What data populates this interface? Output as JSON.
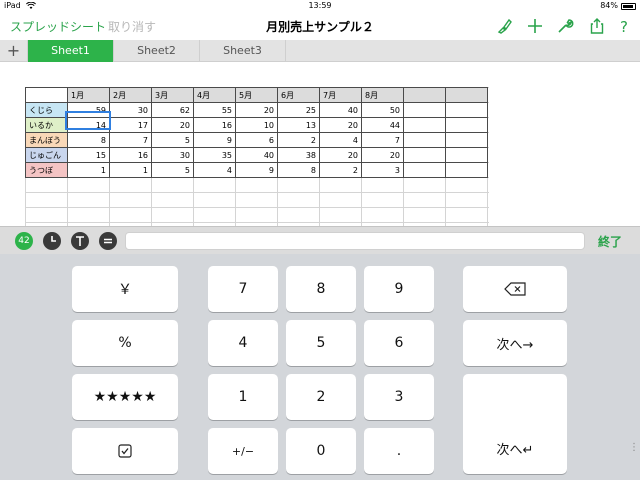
{
  "status": {
    "carrier": "iPad",
    "time": "13:59",
    "battery": "84%"
  },
  "toolbar": {
    "spreadsheets_label": "スプレッドシート",
    "undo_label": "取り消す",
    "title": "月別売上サンプル２"
  },
  "tabs": {
    "add": "+",
    "items": [
      "Sheet1",
      "Sheet2",
      "Sheet3"
    ],
    "active": 0
  },
  "table": {
    "columns": [
      "1月",
      "2月",
      "3月",
      "4月",
      "5月",
      "6月",
      "7月",
      "8月",
      "",
      ""
    ],
    "rows": [
      {
        "label": "くじら",
        "color": "#c7e6f4",
        "values": [
          "59",
          "30",
          "62",
          "55",
          "20",
          "25",
          "40",
          "50",
          "",
          ""
        ]
      },
      {
        "label": "いるか",
        "color": "#dff0c8",
        "values": [
          "14",
          "17",
          "20",
          "16",
          "10",
          "13",
          "20",
          "44",
          "",
          ""
        ]
      },
      {
        "label": "まんぼう",
        "color": "#f9d8b8",
        "values": [
          "8",
          "7",
          "5",
          "9",
          "6",
          "2",
          "4",
          "7",
          "",
          ""
        ]
      },
      {
        "label": "じゅごん",
        "color": "#c9d6ee",
        "values": [
          "15",
          "16",
          "30",
          "35",
          "40",
          "38",
          "20",
          "20",
          "",
          ""
        ]
      },
      {
        "label": "うつぼ",
        "color": "#f4c4c4",
        "values": [
          "1",
          "1",
          "5",
          "4",
          "9",
          "8",
          "2",
          "3",
          "",
          ""
        ]
      }
    ]
  },
  "formula_bar": {
    "number_label": "42",
    "done_label": "終了"
  },
  "keypad": {
    "yen": "￥",
    "percent": "%",
    "stars": "★★★★★",
    "seven": "7",
    "eight": "8",
    "nine": "9",
    "four": "4",
    "five": "5",
    "six": "6",
    "one": "1",
    "two": "2",
    "three": "3",
    "plusminus": "+/−",
    "zero": "0",
    "decimal": ".",
    "next_right": "次へ→",
    "next_enter": "次へ↵"
  },
  "colors": {
    "accent": "#2db34a",
    "selection": "#2f7fe0"
  }
}
